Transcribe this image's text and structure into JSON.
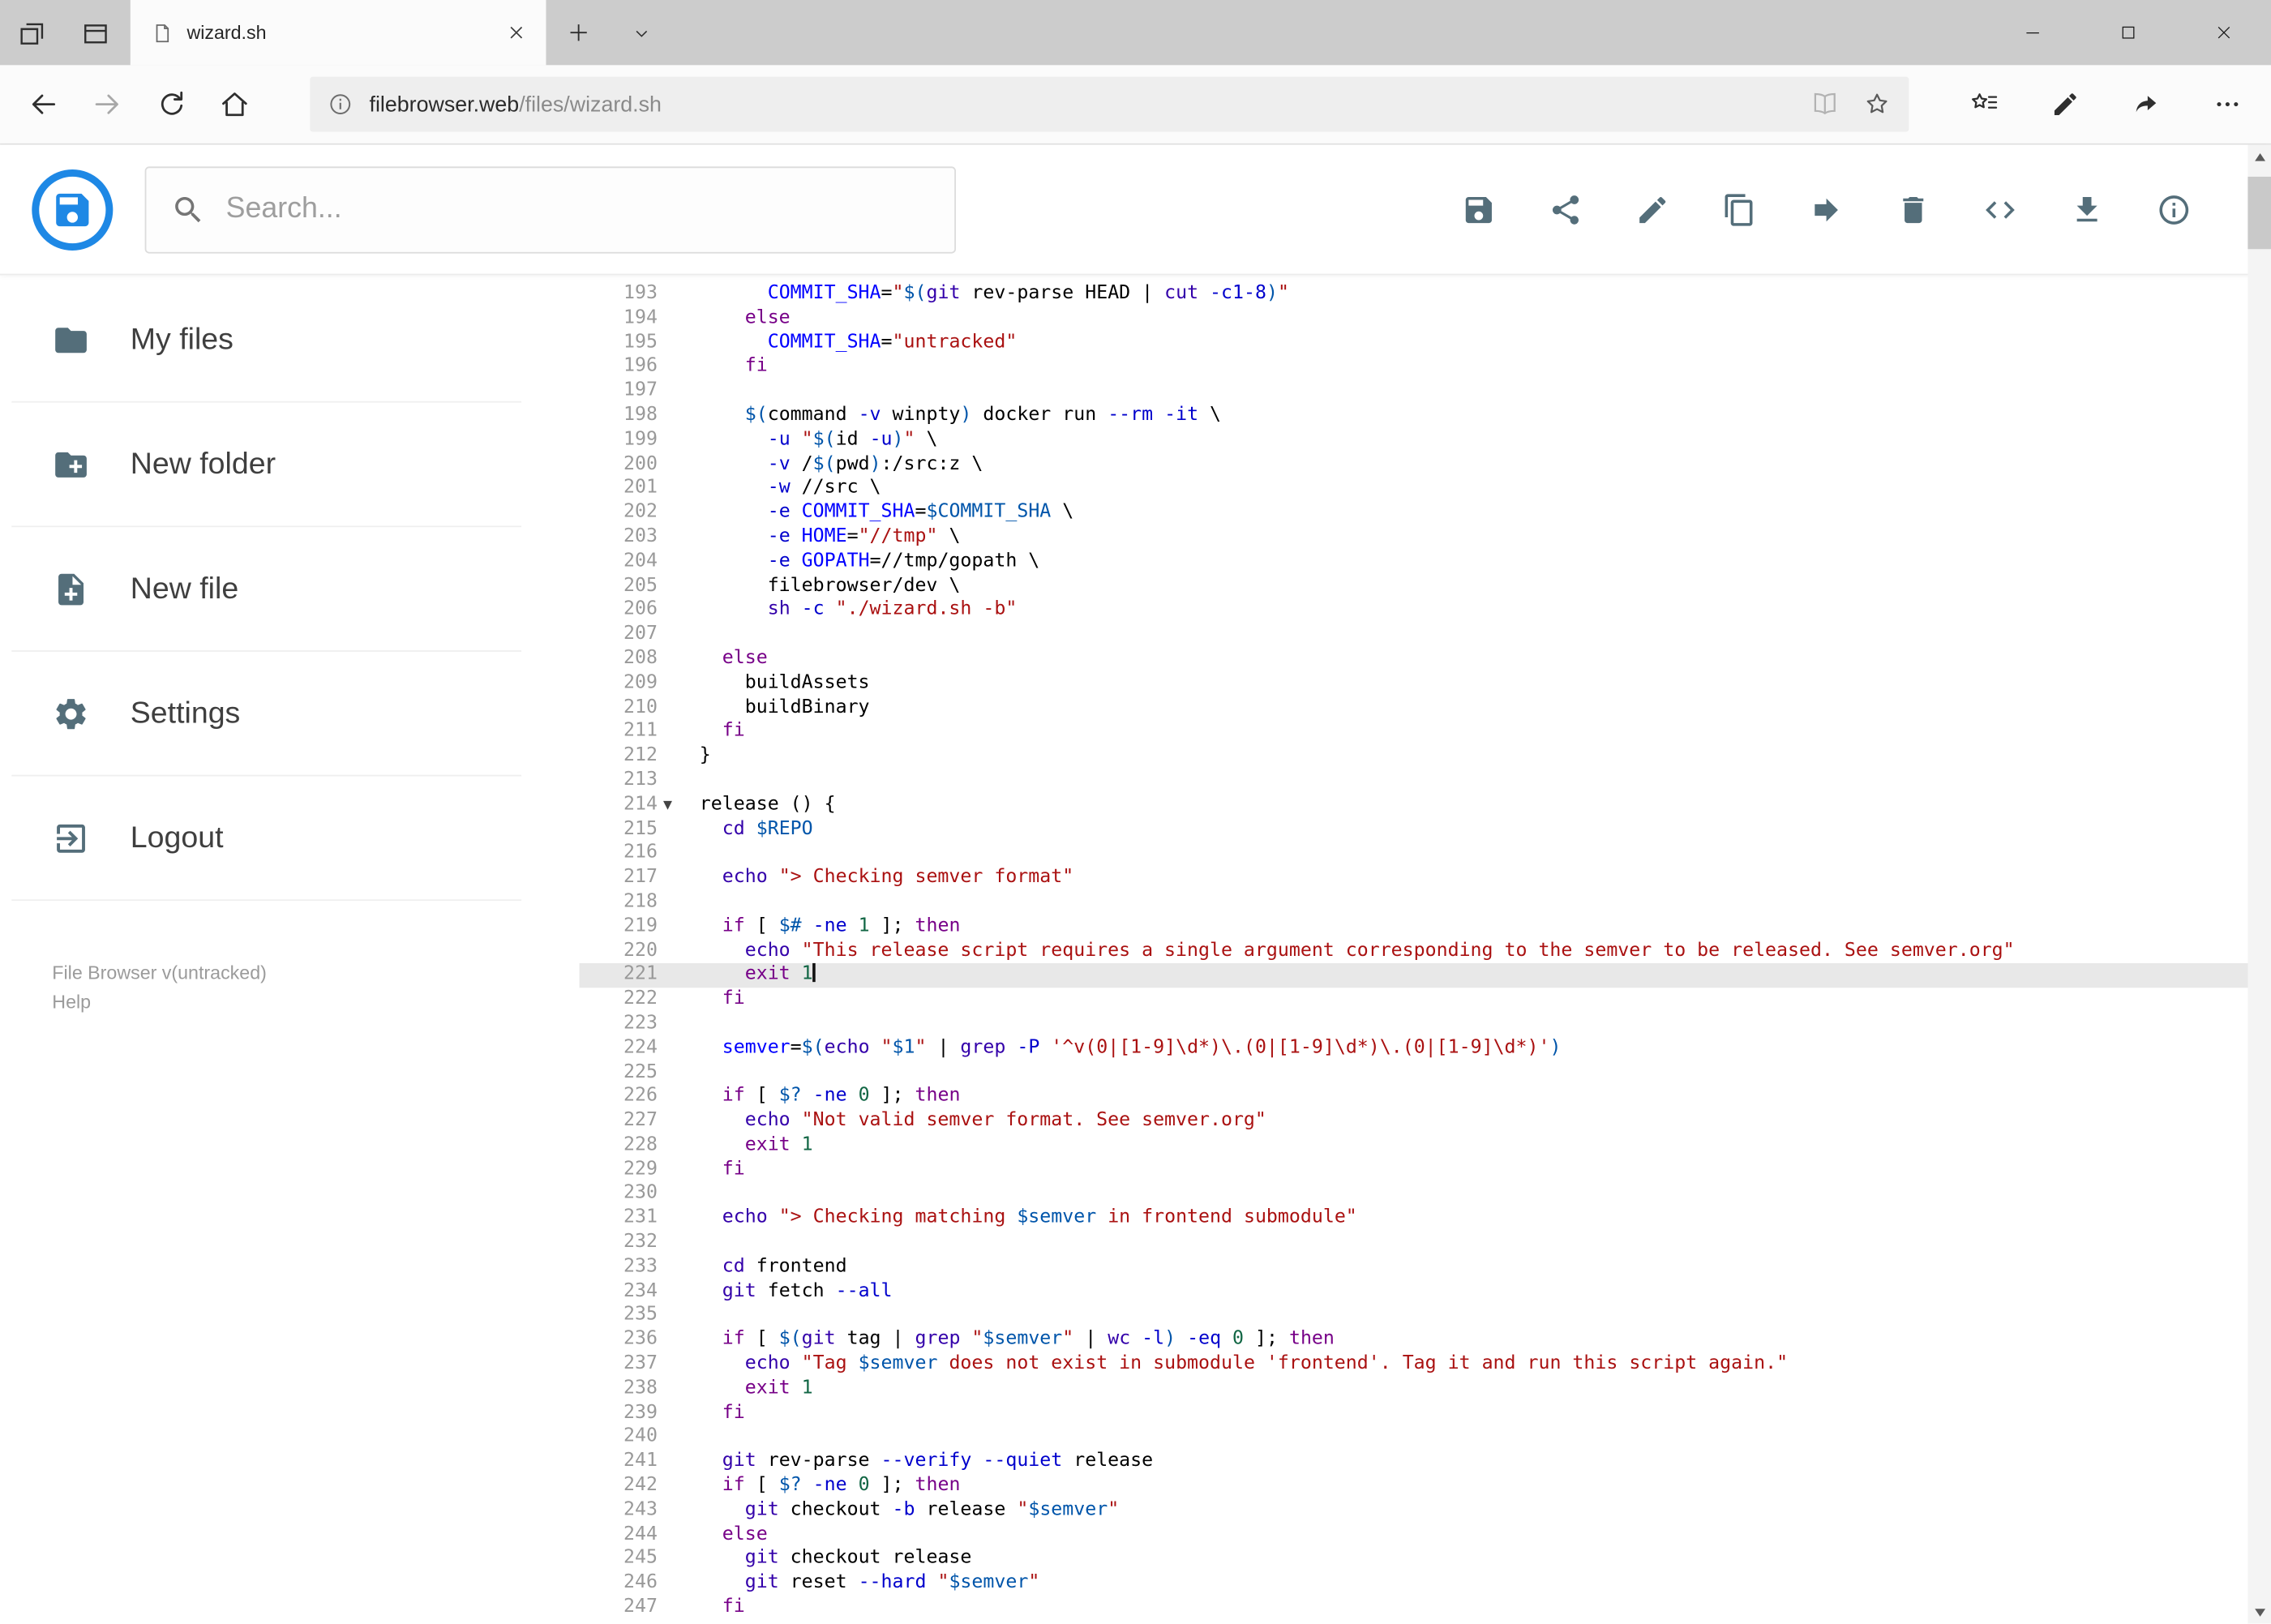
{
  "browser": {
    "tab_title": "wizard.sh",
    "url_domain": "filebrowser.web",
    "url_path": "/files/wizard.sh"
  },
  "app": {
    "search_placeholder": "Search...",
    "sidebar": {
      "items": [
        {
          "label": "My files"
        },
        {
          "label": "New folder"
        },
        {
          "label": "New file"
        },
        {
          "label": "Settings"
        },
        {
          "label": "Logout"
        }
      ],
      "version": "File Browser v(untracked)",
      "help": "Help"
    }
  },
  "colors": {
    "brand_blue": "#1e88e5",
    "tab_bar": "#cccccc",
    "active_line_bg": "#e8e8e8",
    "syntax": {
      "keyword": "#770088",
      "builtin": "#3300aa",
      "definition": "#0000ff",
      "flag": "#0000cc",
      "variable": "#0055aa",
      "number": "#116644",
      "string": "#aa1111"
    }
  },
  "editor": {
    "active_line": 221,
    "cursor_line": 221,
    "fold_markers": [
      214
    ],
    "lines": [
      {
        "n": 193,
        "tokens": [
          [
            "pl",
            "      "
          ],
          [
            "def",
            "COMMIT_SHA"
          ],
          [
            "pl",
            "="
          ],
          [
            "str",
            "\""
          ],
          [
            "v2",
            "$("
          ],
          [
            "bi",
            "git"
          ],
          [
            "pl",
            " rev-parse HEAD | "
          ],
          [
            "bi",
            "cut"
          ],
          [
            "pl",
            " "
          ],
          [
            "att",
            "-c1-8"
          ],
          [
            "v2",
            ")"
          ],
          [
            "str",
            "\""
          ]
        ]
      },
      {
        "n": 194,
        "tokens": [
          [
            "pl",
            "    "
          ],
          [
            "kw",
            "else"
          ]
        ]
      },
      {
        "n": 195,
        "tokens": [
          [
            "pl",
            "      "
          ],
          [
            "def",
            "COMMIT_SHA"
          ],
          [
            "pl",
            "="
          ],
          [
            "str",
            "\"untracked\""
          ]
        ]
      },
      {
        "n": 196,
        "tokens": [
          [
            "pl",
            "    "
          ],
          [
            "kw",
            "fi"
          ]
        ]
      },
      {
        "n": 197,
        "tokens": []
      },
      {
        "n": 198,
        "tokens": [
          [
            "pl",
            "    "
          ],
          [
            "v2",
            "$("
          ],
          [
            "pl",
            "command "
          ],
          [
            "att",
            "-v"
          ],
          [
            "pl",
            " winpty"
          ],
          [
            "v2",
            ")"
          ],
          [
            "pl",
            " docker run "
          ],
          [
            "att",
            "--rm"
          ],
          [
            "pl",
            " "
          ],
          [
            "att",
            "-it"
          ],
          [
            "pl",
            " \\"
          ]
        ]
      },
      {
        "n": 199,
        "tokens": [
          [
            "pl",
            "      "
          ],
          [
            "att",
            "-u"
          ],
          [
            "pl",
            " "
          ],
          [
            "str",
            "\""
          ],
          [
            "v2",
            "$("
          ],
          [
            "pl",
            "id "
          ],
          [
            "att",
            "-u"
          ],
          [
            "v2",
            ")"
          ],
          [
            "str",
            "\""
          ],
          [
            "pl",
            " \\"
          ]
        ]
      },
      {
        "n": 200,
        "tokens": [
          [
            "pl",
            "      "
          ],
          [
            "att",
            "-v"
          ],
          [
            "pl",
            " /"
          ],
          [
            "v2",
            "$("
          ],
          [
            "pl",
            "pwd"
          ],
          [
            "v2",
            ")"
          ],
          [
            "pl",
            ":/src:z \\"
          ]
        ]
      },
      {
        "n": 201,
        "tokens": [
          [
            "pl",
            "      "
          ],
          [
            "att",
            "-w"
          ],
          [
            "pl",
            " //src \\"
          ]
        ]
      },
      {
        "n": 202,
        "tokens": [
          [
            "pl",
            "      "
          ],
          [
            "att",
            "-e"
          ],
          [
            "pl",
            " "
          ],
          [
            "def",
            "COMMIT_SHA"
          ],
          [
            "pl",
            "="
          ],
          [
            "v2",
            "$COMMIT_SHA"
          ],
          [
            "pl",
            " \\"
          ]
        ]
      },
      {
        "n": 203,
        "tokens": [
          [
            "pl",
            "      "
          ],
          [
            "att",
            "-e"
          ],
          [
            "pl",
            " "
          ],
          [
            "def",
            "HOME"
          ],
          [
            "pl",
            "="
          ],
          [
            "str",
            "\"//tmp\""
          ],
          [
            "pl",
            " \\"
          ]
        ]
      },
      {
        "n": 204,
        "tokens": [
          [
            "pl",
            "      "
          ],
          [
            "att",
            "-e"
          ],
          [
            "pl",
            " "
          ],
          [
            "def",
            "GOPATH"
          ],
          [
            "pl",
            "=//tmp/gopath \\"
          ]
        ]
      },
      {
        "n": 205,
        "tokens": [
          [
            "pl",
            "      filebrowser/dev \\"
          ]
        ]
      },
      {
        "n": 206,
        "tokens": [
          [
            "pl",
            "      "
          ],
          [
            "bi",
            "sh"
          ],
          [
            "pl",
            " "
          ],
          [
            "att",
            "-c"
          ],
          [
            "pl",
            " "
          ],
          [
            "str",
            "\"./wizard.sh -b\""
          ]
        ]
      },
      {
        "n": 207,
        "tokens": []
      },
      {
        "n": 208,
        "tokens": [
          [
            "pl",
            "  "
          ],
          [
            "kw",
            "else"
          ]
        ]
      },
      {
        "n": 209,
        "tokens": [
          [
            "pl",
            "    buildAssets"
          ]
        ]
      },
      {
        "n": 210,
        "tokens": [
          [
            "pl",
            "    buildBinary"
          ]
        ]
      },
      {
        "n": 211,
        "tokens": [
          [
            "pl",
            "  "
          ],
          [
            "kw",
            "fi"
          ]
        ]
      },
      {
        "n": 212,
        "tokens": [
          [
            "pl",
            "}"
          ]
        ]
      },
      {
        "n": 213,
        "tokens": []
      },
      {
        "n": 214,
        "tokens": [
          [
            "pl",
            "release () {"
          ]
        ]
      },
      {
        "n": 215,
        "tokens": [
          [
            "pl",
            "  "
          ],
          [
            "bi",
            "cd"
          ],
          [
            "pl",
            " "
          ],
          [
            "v2",
            "$REPO"
          ]
        ]
      },
      {
        "n": 216,
        "tokens": []
      },
      {
        "n": 217,
        "tokens": [
          [
            "pl",
            "  "
          ],
          [
            "bi",
            "echo"
          ],
          [
            "pl",
            " "
          ],
          [
            "str",
            "\"> Checking semver format\""
          ]
        ]
      },
      {
        "n": 218,
        "tokens": []
      },
      {
        "n": 219,
        "tokens": [
          [
            "pl",
            "  "
          ],
          [
            "kw",
            "if"
          ],
          [
            "pl",
            " [ "
          ],
          [
            "v2",
            "$#"
          ],
          [
            "pl",
            " "
          ],
          [
            "att",
            "-ne"
          ],
          [
            "pl",
            " "
          ],
          [
            "num",
            "1"
          ],
          [
            "pl",
            " ]; "
          ],
          [
            "kw",
            "then"
          ]
        ]
      },
      {
        "n": 220,
        "tokens": [
          [
            "pl",
            "    "
          ],
          [
            "bi",
            "echo"
          ],
          [
            "pl",
            " "
          ],
          [
            "str",
            "\"This release script requires a single argument corresponding to the semver to be released. See semver.org\""
          ]
        ]
      },
      {
        "n": 221,
        "tokens": [
          [
            "pl",
            "    "
          ],
          [
            "kw",
            "exit"
          ],
          [
            "pl",
            " "
          ],
          [
            "num",
            "1"
          ]
        ]
      },
      {
        "n": 222,
        "tokens": [
          [
            "pl",
            "  "
          ],
          [
            "kw",
            "fi"
          ]
        ]
      },
      {
        "n": 223,
        "tokens": []
      },
      {
        "n": 224,
        "tokens": [
          [
            "pl",
            "  "
          ],
          [
            "def",
            "semver"
          ],
          [
            "pl",
            "="
          ],
          [
            "v2",
            "$("
          ],
          [
            "bi",
            "echo"
          ],
          [
            "pl",
            " "
          ],
          [
            "str",
            "\""
          ],
          [
            "v2",
            "$1"
          ],
          [
            "str",
            "\""
          ],
          [
            "pl",
            " | "
          ],
          [
            "bi",
            "grep"
          ],
          [
            "pl",
            " "
          ],
          [
            "att",
            "-P"
          ],
          [
            "pl",
            " "
          ],
          [
            "str",
            "'^v(0|[1-9]\\d*)\\.(0|[1-9]\\d*)\\.(0|[1-9]\\d*)'"
          ],
          [
            "v2",
            ")"
          ]
        ]
      },
      {
        "n": 225,
        "tokens": []
      },
      {
        "n": 226,
        "tokens": [
          [
            "pl",
            "  "
          ],
          [
            "kw",
            "if"
          ],
          [
            "pl",
            " [ "
          ],
          [
            "v2",
            "$?"
          ],
          [
            "pl",
            " "
          ],
          [
            "att",
            "-ne"
          ],
          [
            "pl",
            " "
          ],
          [
            "num",
            "0"
          ],
          [
            "pl",
            " ]; "
          ],
          [
            "kw",
            "then"
          ]
        ]
      },
      {
        "n": 227,
        "tokens": [
          [
            "pl",
            "    "
          ],
          [
            "bi",
            "echo"
          ],
          [
            "pl",
            " "
          ],
          [
            "str",
            "\"Not valid semver format. See semver.org\""
          ]
        ]
      },
      {
        "n": 228,
        "tokens": [
          [
            "pl",
            "    "
          ],
          [
            "kw",
            "exit"
          ],
          [
            "pl",
            " "
          ],
          [
            "num",
            "1"
          ]
        ]
      },
      {
        "n": 229,
        "tokens": [
          [
            "pl",
            "  "
          ],
          [
            "kw",
            "fi"
          ]
        ]
      },
      {
        "n": 230,
        "tokens": []
      },
      {
        "n": 231,
        "tokens": [
          [
            "pl",
            "  "
          ],
          [
            "bi",
            "echo"
          ],
          [
            "pl",
            " "
          ],
          [
            "str",
            "\"> Checking matching "
          ],
          [
            "v2",
            "$semver"
          ],
          [
            "str",
            " in frontend submodule\""
          ]
        ]
      },
      {
        "n": 232,
        "tokens": []
      },
      {
        "n": 233,
        "tokens": [
          [
            "pl",
            "  "
          ],
          [
            "bi",
            "cd"
          ],
          [
            "pl",
            " frontend"
          ]
        ]
      },
      {
        "n": 234,
        "tokens": [
          [
            "pl",
            "  "
          ],
          [
            "bi",
            "git"
          ],
          [
            "pl",
            " fetch "
          ],
          [
            "att",
            "--all"
          ]
        ]
      },
      {
        "n": 235,
        "tokens": []
      },
      {
        "n": 236,
        "tokens": [
          [
            "pl",
            "  "
          ],
          [
            "kw",
            "if"
          ],
          [
            "pl",
            " [ "
          ],
          [
            "v2",
            "$("
          ],
          [
            "bi",
            "git"
          ],
          [
            "pl",
            " tag | "
          ],
          [
            "bi",
            "grep"
          ],
          [
            "pl",
            " "
          ],
          [
            "str",
            "\""
          ],
          [
            "v2",
            "$semver"
          ],
          [
            "str",
            "\""
          ],
          [
            "pl",
            " | "
          ],
          [
            "bi",
            "wc"
          ],
          [
            "pl",
            " "
          ],
          [
            "att",
            "-l"
          ],
          [
            "v2",
            ")"
          ],
          [
            "pl",
            " "
          ],
          [
            "att",
            "-eq"
          ],
          [
            "pl",
            " "
          ],
          [
            "num",
            "0"
          ],
          [
            "pl",
            " ]; "
          ],
          [
            "kw",
            "then"
          ]
        ]
      },
      {
        "n": 237,
        "tokens": [
          [
            "pl",
            "    "
          ],
          [
            "bi",
            "echo"
          ],
          [
            "pl",
            " "
          ],
          [
            "str",
            "\"Tag "
          ],
          [
            "v2",
            "$semver"
          ],
          [
            "str",
            " does not exist in submodule 'frontend'. Tag it and run this script again.\""
          ]
        ]
      },
      {
        "n": 238,
        "tokens": [
          [
            "pl",
            "    "
          ],
          [
            "kw",
            "exit"
          ],
          [
            "pl",
            " "
          ],
          [
            "num",
            "1"
          ]
        ]
      },
      {
        "n": 239,
        "tokens": [
          [
            "pl",
            "  "
          ],
          [
            "kw",
            "fi"
          ]
        ]
      },
      {
        "n": 240,
        "tokens": []
      },
      {
        "n": 241,
        "tokens": [
          [
            "pl",
            "  "
          ],
          [
            "bi",
            "git"
          ],
          [
            "pl",
            " rev-parse "
          ],
          [
            "att",
            "--verify"
          ],
          [
            "pl",
            " "
          ],
          [
            "att",
            "--quiet"
          ],
          [
            "pl",
            " release"
          ]
        ]
      },
      {
        "n": 242,
        "tokens": [
          [
            "pl",
            "  "
          ],
          [
            "kw",
            "if"
          ],
          [
            "pl",
            " [ "
          ],
          [
            "v2",
            "$?"
          ],
          [
            "pl",
            " "
          ],
          [
            "att",
            "-ne"
          ],
          [
            "pl",
            " "
          ],
          [
            "num",
            "0"
          ],
          [
            "pl",
            " ]; "
          ],
          [
            "kw",
            "then"
          ]
        ]
      },
      {
        "n": 243,
        "tokens": [
          [
            "pl",
            "    "
          ],
          [
            "bi",
            "git"
          ],
          [
            "pl",
            " checkout "
          ],
          [
            "att",
            "-b"
          ],
          [
            "pl",
            " release "
          ],
          [
            "str",
            "\""
          ],
          [
            "v2",
            "$semver"
          ],
          [
            "str",
            "\""
          ]
        ]
      },
      {
        "n": 244,
        "tokens": [
          [
            "pl",
            "  "
          ],
          [
            "kw",
            "else"
          ]
        ]
      },
      {
        "n": 245,
        "tokens": [
          [
            "pl",
            "    "
          ],
          [
            "bi",
            "git"
          ],
          [
            "pl",
            " checkout release"
          ]
        ]
      },
      {
        "n": 246,
        "tokens": [
          [
            "pl",
            "    "
          ],
          [
            "bi",
            "git"
          ],
          [
            "pl",
            " reset "
          ],
          [
            "att",
            "--hard"
          ],
          [
            "pl",
            " "
          ],
          [
            "str",
            "\""
          ],
          [
            "v2",
            "$semver"
          ],
          [
            "str",
            "\""
          ]
        ]
      },
      {
        "n": 247,
        "tokens": [
          [
            "pl",
            "  "
          ],
          [
            "kw",
            "fi"
          ]
        ]
      }
    ]
  }
}
